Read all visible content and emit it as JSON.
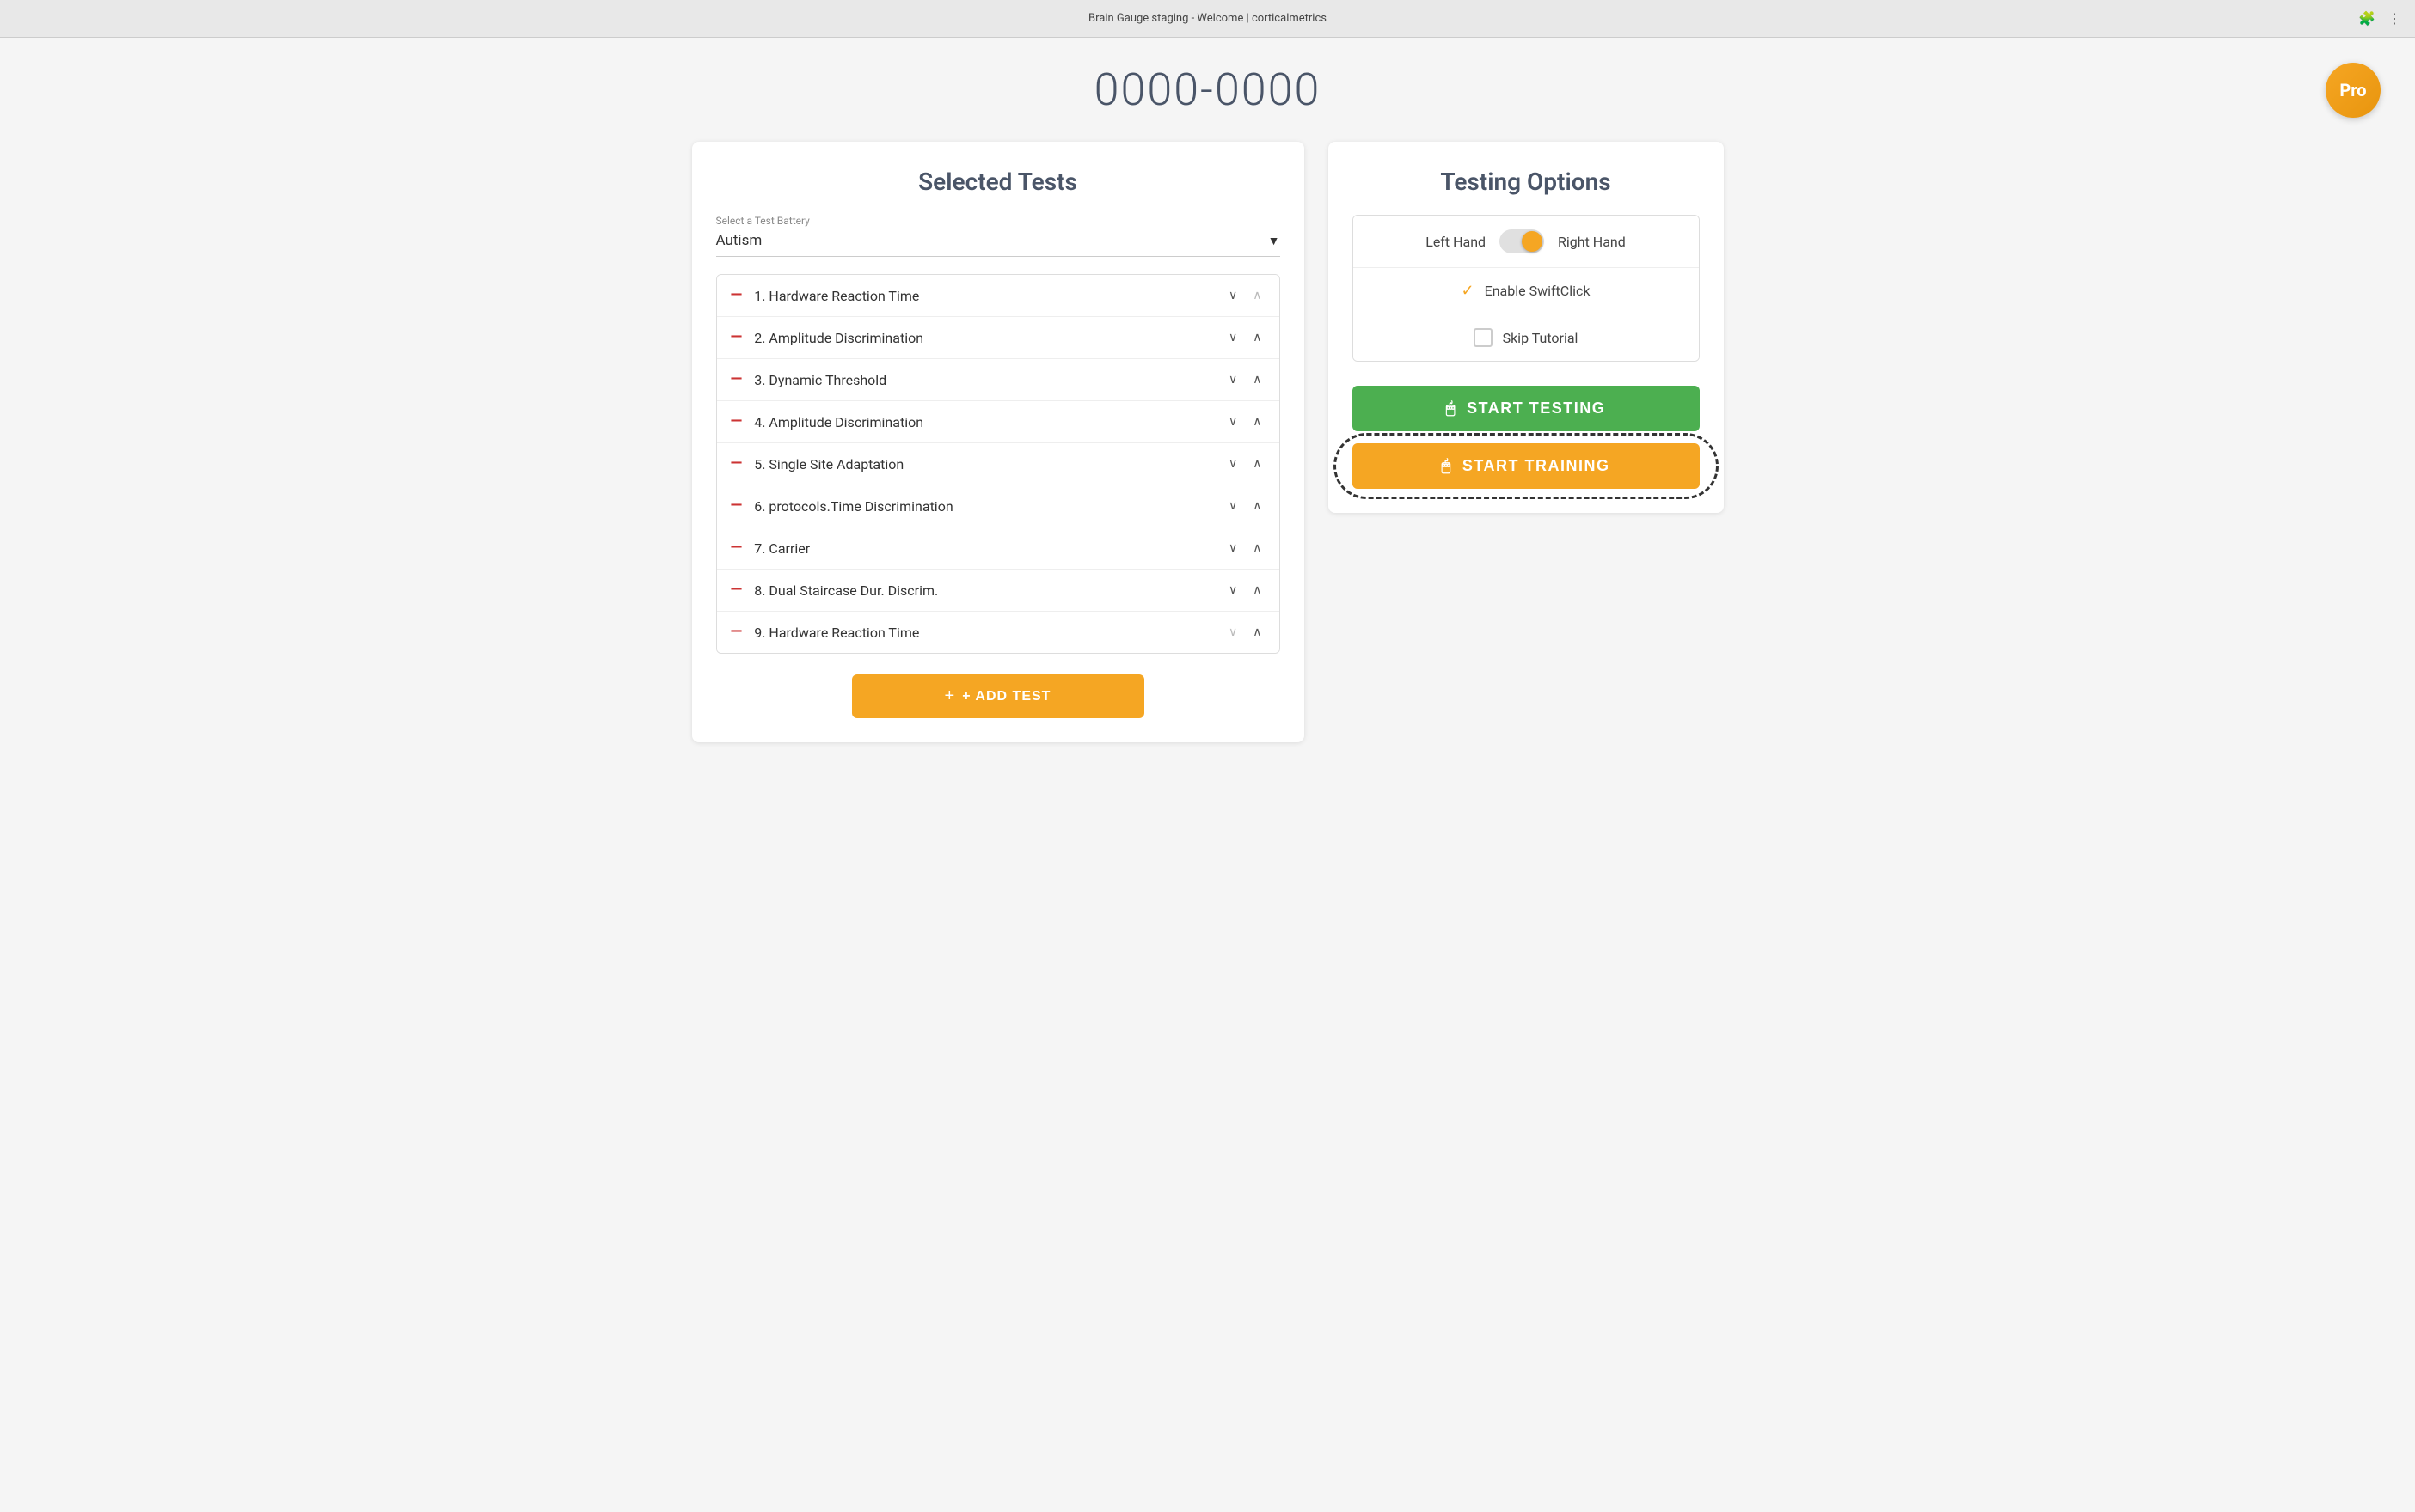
{
  "browser": {
    "title": "Brain Gauge staging - Welcome | corticalmetrics",
    "icons": [
      "puzzle-icon",
      "ellipsis-icon"
    ]
  },
  "header": {
    "title": "0000-0000",
    "pro_badge": "Pro"
  },
  "left_panel": {
    "heading": "Selected Tests",
    "battery_label": "Select a Test Battery",
    "battery_value": "Autism",
    "tests": [
      {
        "number": "1.",
        "name": "Hardware Reaction Time",
        "has_up": false
      },
      {
        "number": "2.",
        "name": "Amplitude Discrimination",
        "has_up": true
      },
      {
        "number": "3.",
        "name": "Dynamic Threshold",
        "has_up": true
      },
      {
        "number": "4.",
        "name": "Amplitude Discrimination",
        "has_up": true
      },
      {
        "number": "5.",
        "name": "Single Site Adaptation",
        "has_up": true
      },
      {
        "number": "6.",
        "name": "protocols.Time Discrimination",
        "has_up": true
      },
      {
        "number": "7.",
        "name": "Carrier",
        "has_up": true
      },
      {
        "number": "8.",
        "name": "Dual Staircase Dur. Discrim.",
        "has_up": true
      },
      {
        "number": "9.",
        "name": "Hardware Reaction Time",
        "has_up": true
      }
    ],
    "add_test_label": "+ ADD TEST"
  },
  "right_panel": {
    "heading": "Testing Options",
    "options": {
      "left_hand_label": "Left Hand",
      "right_hand_label": "Right Hand",
      "swiftclick_label": "Enable SwiftClick",
      "skip_tutorial_label": "Skip Tutorial"
    },
    "start_testing_label": "START TESTING",
    "start_training_label": "START TRAINING"
  }
}
